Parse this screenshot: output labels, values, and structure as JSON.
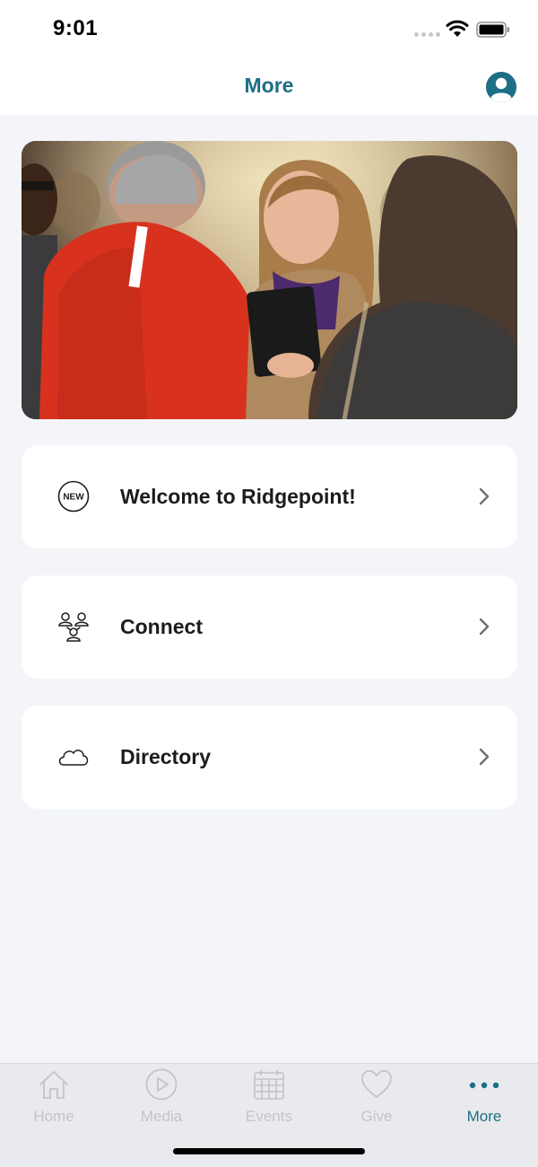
{
  "status_bar": {
    "time": "9:01"
  },
  "nav": {
    "title": "More",
    "profile_icon": "person-circle-icon"
  },
  "hero": {
    "image": "people-greeting-photo"
  },
  "menu": [
    {
      "label": "Welcome to Ridgepoint!",
      "icon": "new-badge-icon"
    },
    {
      "label": "Connect",
      "icon": "people-group-icon"
    },
    {
      "label": "Directory",
      "icon": "cloud-icon"
    }
  ],
  "tabs": [
    {
      "label": "Home",
      "icon": "house-icon",
      "active": false
    },
    {
      "label": "Media",
      "icon": "play-circle-icon",
      "active": false
    },
    {
      "label": "Events",
      "icon": "calendar-icon",
      "active": false
    },
    {
      "label": "Give",
      "icon": "heart-icon",
      "active": false
    },
    {
      "label": "More",
      "icon": "more-dots-icon",
      "active": true
    }
  ],
  "new_badge_text": "NEW",
  "colors": {
    "accent": "#1d6f86",
    "background": "#f3f5f9",
    "card": "#ffffff",
    "tab_inactive": "#c2c4c8"
  }
}
